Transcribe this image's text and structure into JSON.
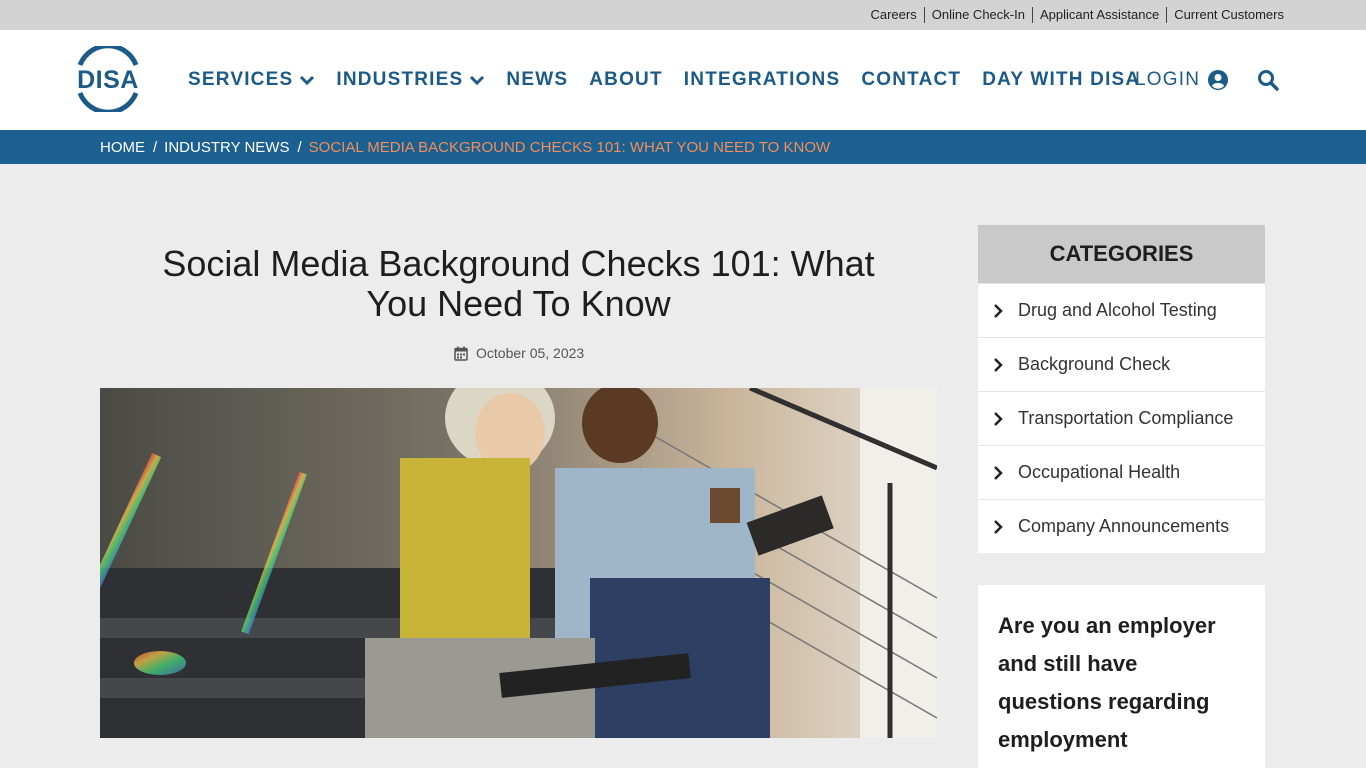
{
  "utility": {
    "links": [
      "Careers",
      "Online Check-In",
      "Applicant Assistance",
      "Current Customers"
    ]
  },
  "header": {
    "logo_text": "DISA",
    "nav": [
      {
        "label": "SERVICES",
        "dropdown": true
      },
      {
        "label": "INDUSTRIES",
        "dropdown": true
      },
      {
        "label": "NEWS",
        "dropdown": false
      },
      {
        "label": "ABOUT",
        "dropdown": false
      },
      {
        "label": "INTEGRATIONS",
        "dropdown": false
      },
      {
        "label": "CONTACT",
        "dropdown": false
      },
      {
        "label": "DAY WITH DISA",
        "dropdown": false
      }
    ],
    "login_label": "LOGIN",
    "login_icon": "user-circle-icon",
    "search_icon": "search-icon"
  },
  "breadcrumb": {
    "items": [
      "HOME",
      "INDUSTRY NEWS",
      "SOCIAL MEDIA BACKGROUND CHECKS 101: WHAT YOU NEED TO KNOW"
    ]
  },
  "article": {
    "title": "Social Media Background Checks 101: What You Need To Know",
    "date": "October 05, 2023",
    "date_icon": "calendar-icon"
  },
  "sidebar": {
    "categories_title": "CATEGORIES",
    "categories": [
      "Drug and Alcohol Testing",
      "Background Check",
      "Transportation Compliance",
      "Occupational Health",
      "Company Announcements"
    ],
    "cta_text": "Are you an employer and still have questions regarding employment screening?"
  },
  "colors": {
    "brand_blue": "#1c5a87",
    "breadcrumb_bar": "#1b6091",
    "breadcrumb_current": "#f08e5c",
    "utility_bar": "#d3d3d3",
    "page_bg": "#ececec",
    "category_header": "#c9c9c9"
  }
}
